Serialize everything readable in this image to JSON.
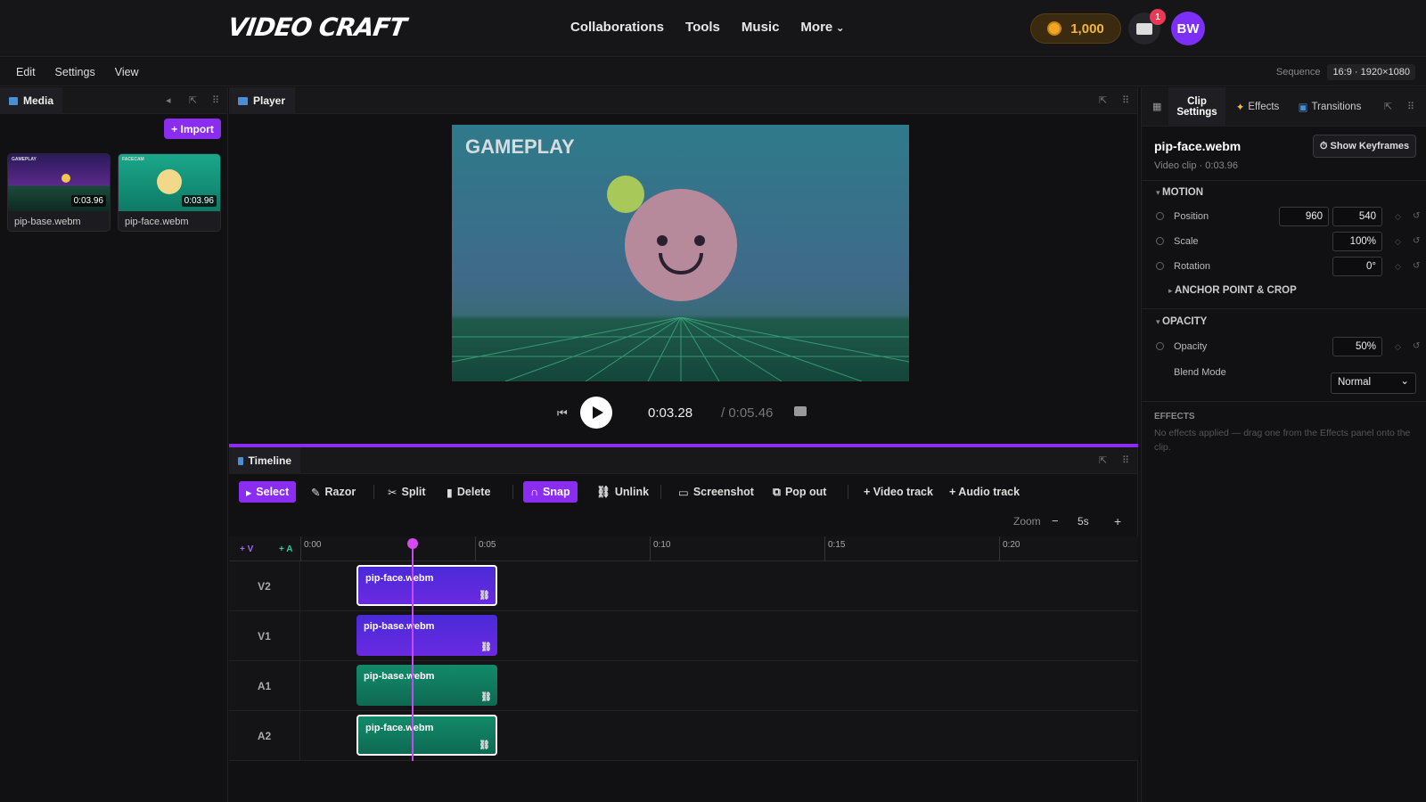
{
  "app": {
    "logo": "VIDEO CRAFT"
  },
  "nav": {
    "links": [
      "Collaborations",
      "Tools",
      "Music",
      "More"
    ],
    "coins": "1,000",
    "mail_badge": "1",
    "avatar": "BW"
  },
  "menubar": {
    "items": [
      "Edit",
      "Settings",
      "View"
    ],
    "sequence_label": "Sequence",
    "sequence_value": "16:9 · 1920×1080"
  },
  "media": {
    "title": "Media",
    "import_label": "+ Import",
    "items": [
      {
        "name": "pip-base.webm",
        "duration": "0:03.96",
        "thumb_label": "GAMEPLAY"
      },
      {
        "name": "pip-face.webm",
        "duration": "0:03.96",
        "thumb_label": "FACECAM"
      }
    ]
  },
  "player": {
    "title": "Player",
    "preview_text": "GAMEPLAY",
    "current_time": "0:03.28",
    "total_time": "/ 0:05.46"
  },
  "timeline": {
    "title": "Timeline",
    "tools": [
      "Select",
      "Razor",
      "Split",
      "Delete",
      "Snap",
      "Unlink",
      "Screenshot",
      "Pop out",
      "+ Video track",
      "+ Audio track"
    ],
    "zoom_label": "Zoom",
    "zoom_value": "5s",
    "add_video": "+ V",
    "add_audio": "+ A",
    "ruler": [
      "0:00",
      "0:05",
      "0:10",
      "0:15",
      "0:20"
    ],
    "tracks": [
      {
        "name": "V2",
        "clip": "pip-face.webm",
        "kind": "video",
        "selected": true
      },
      {
        "name": "V1",
        "clip": "pip-base.webm",
        "kind": "video",
        "selected": false
      },
      {
        "name": "A1",
        "clip": "pip-base.webm",
        "kind": "audio",
        "selected": false
      },
      {
        "name": "A2",
        "clip": "pip-face.webm",
        "kind": "audio",
        "selected": true
      }
    ]
  },
  "inspector": {
    "tabs": [
      "Clip Settings",
      "Effects",
      "Transitions"
    ],
    "clip_name": "pip-face.webm",
    "clip_meta": "Video clip · 0:03.96",
    "keyframes_btn": "Show Keyframes",
    "motion": "MOTION",
    "position_label": "Position",
    "position_x": "960",
    "position_y": "540",
    "scale_label": "Scale",
    "scale_value": "100%",
    "rotation_label": "Rotation",
    "rotation_value": "0°",
    "anchor": "ANCHOR POINT & CROP",
    "opacity_section": "OPACITY",
    "opacity_label": "Opacity",
    "opacity_value": "50%",
    "blend_label": "Blend Mode",
    "blend_value": "Normal",
    "effects_section": "EFFECTS",
    "effects_note": "No effects applied — drag one from the Effects panel onto the clip."
  },
  "colors": {
    "accent": "#8b2df0",
    "video_clip": "#5a2ae0",
    "audio_clip": "#128a6a",
    "playhead": "#d64af0"
  }
}
